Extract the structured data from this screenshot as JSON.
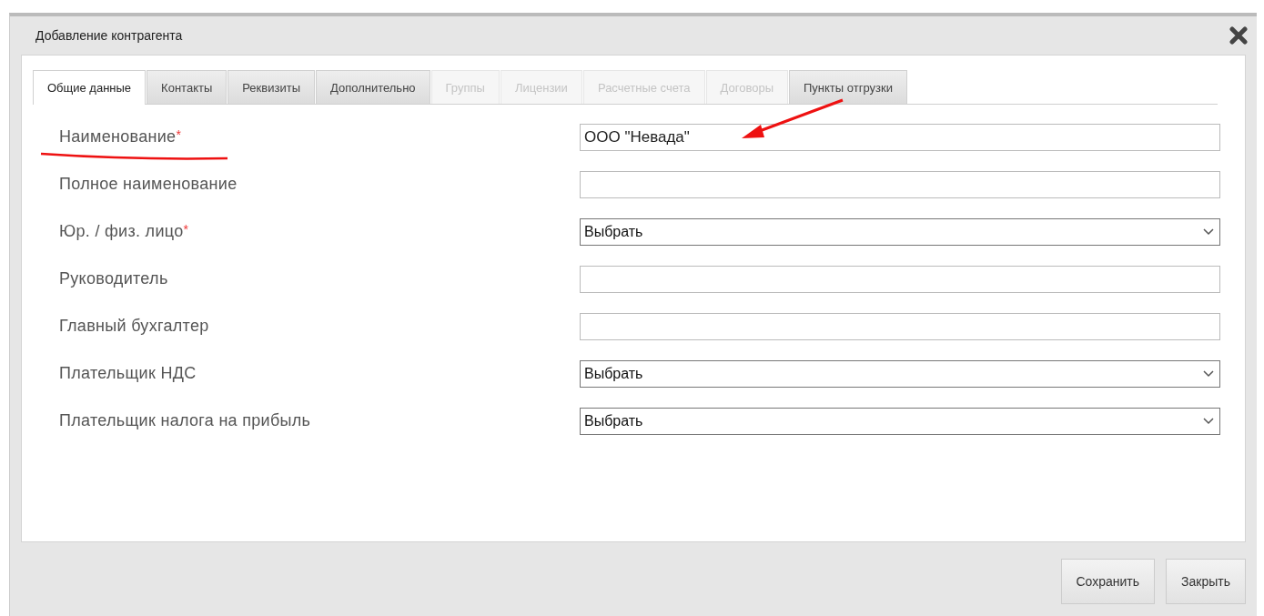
{
  "window": {
    "title": "Добавление контрагента"
  },
  "tabs": [
    {
      "label": "Общие данные",
      "selected": true,
      "disabled": false
    },
    {
      "label": "Контакты",
      "selected": false,
      "disabled": false
    },
    {
      "label": "Реквизиты",
      "selected": false,
      "disabled": false
    },
    {
      "label": "Дополнительно",
      "selected": false,
      "disabled": false
    },
    {
      "label": "Группы",
      "selected": false,
      "disabled": true
    },
    {
      "label": "Лицензии",
      "selected": false,
      "disabled": true
    },
    {
      "label": "Расчетные счета",
      "selected": false,
      "disabled": true
    },
    {
      "label": "Договоры",
      "selected": false,
      "disabled": true
    },
    {
      "label": "Пункты отгрузки",
      "selected": false,
      "disabled": false
    }
  ],
  "fields": [
    {
      "label": "Наименование",
      "required_mark": "*",
      "kind": "text",
      "value": "ООО \"Невада\""
    },
    {
      "label": "Полное наименование",
      "kind": "text"
    },
    {
      "label": "Юр. / физ. лицо",
      "required_mark": "*",
      "kind": "select",
      "value": "Выбрать"
    },
    {
      "label": "Руководитель",
      "kind": "text"
    },
    {
      "label": "Главный бухгалтер",
      "kind": "text"
    },
    {
      "label": "Плательщик НДС",
      "kind": "select",
      "value": "Выбрать"
    },
    {
      "label": "Плательщик налога на прибыль",
      "kind": "select",
      "value": "Выбрать"
    }
  ],
  "buttons": [
    "Сохранить",
    "Закрыть"
  ]
}
